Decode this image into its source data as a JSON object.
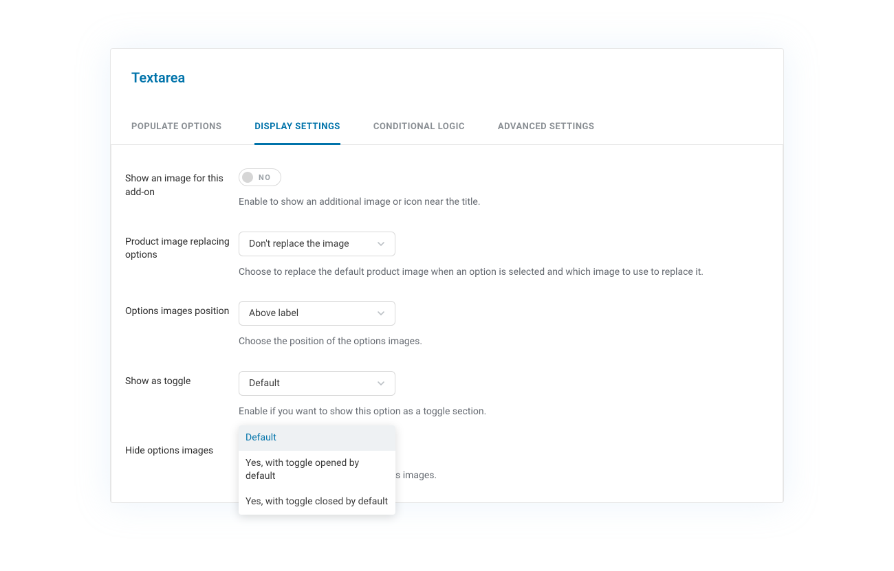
{
  "panel": {
    "title": "Textarea"
  },
  "tabs": [
    {
      "label": "Populate Options",
      "active": false
    },
    {
      "label": "Display Settings",
      "active": true
    },
    {
      "label": "Conditional Logic",
      "active": false
    },
    {
      "label": "Advanced Settings",
      "active": false
    }
  ],
  "fields": {
    "show_image": {
      "label": "Show an image for this add-on",
      "toggle_state": "NO",
      "help": "Enable to show an additional image or icon near the title."
    },
    "product_image_replace": {
      "label": "Product image replacing options",
      "value": "Don't replace the image",
      "help": "Choose to replace the default product image when an option is selected and which image to use to replace it."
    },
    "options_images_position": {
      "label": "Options images position",
      "value": "Above label",
      "help": "Choose the position of the options images."
    },
    "show_as_toggle": {
      "label": "Show as toggle",
      "value": "Default",
      "help": "Enable if you want to show this option as a toggle section.",
      "dropdown_open": true,
      "options": [
        {
          "label": "Default",
          "highlighted": true
        },
        {
          "label": "Yes, with toggle opened by default",
          "highlighted": false
        },
        {
          "label": "Yes, with toggle closed by default",
          "highlighted": false
        }
      ]
    },
    "hide_options_images": {
      "label": "Hide options images",
      "help_suffix": "s images."
    }
  }
}
